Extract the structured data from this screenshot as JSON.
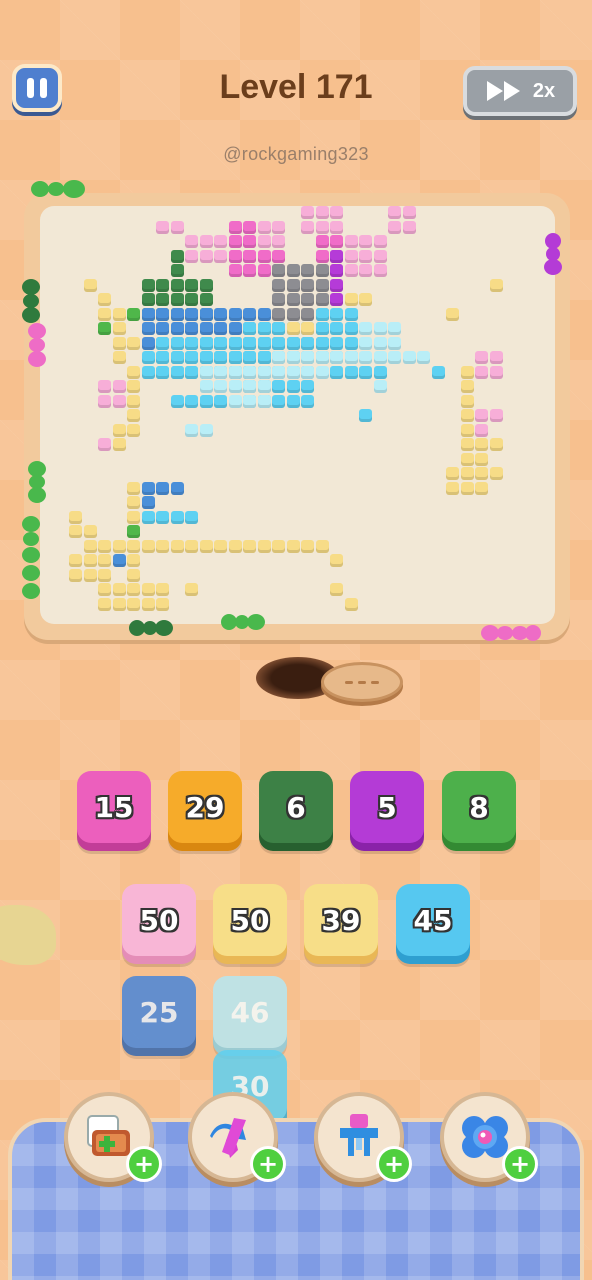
{
  "header": {
    "level_label": "Level 171",
    "watermark": "@rockgaming323",
    "speed_label": "2x"
  },
  "colors": {
    "pink": "#f06cc8",
    "light_pink": "#f7aed8",
    "orange": "#f6ad2a",
    "dark_green": "#3f8a4c",
    "purple": "#b53bd8",
    "green": "#4fb74a",
    "cream": "#f7dc87",
    "yellow": "#f5df8e",
    "cyan": "#5ed1f2",
    "light_cyan": "#b9eef7",
    "blue": "#4a8fd9",
    "grey": "#8d8d92"
  },
  "queue_row": [
    {
      "value": "15",
      "color": "#ec5fbd",
      "dark": "#c23d98"
    },
    {
      "value": "29",
      "color": "#f6ab2a",
      "dark": "#d98710"
    },
    {
      "value": "6",
      "color": "#3d8146",
      "dark": "#27602f"
    },
    {
      "value": "5",
      "color": "#b43bd6",
      "dark": "#8a22a9"
    },
    {
      "value": "8",
      "color": "#4db04b",
      "dark": "#338a33"
    }
  ],
  "stock": [
    {
      "value": "50",
      "color": "#f8b6d6",
      "dark": "#e48db7",
      "faded": false
    },
    {
      "value": "50",
      "color": "#f7de88",
      "dark": "#e9b755",
      "faded": false
    },
    {
      "value": "39",
      "color": "#f7de88",
      "dark": "#e9b755",
      "faded": false
    },
    {
      "value": "45",
      "color": "#56c8f0",
      "dark": "#2f9fd0",
      "faded": false
    },
    {
      "value": "25",
      "color": "#4a86d8",
      "dark": "#3466ad",
      "faded": true
    },
    {
      "value": "46",
      "color": "#b6e7f2",
      "dark": "#8ccddd",
      "faded": true
    },
    {
      "value": "30",
      "color": "#5fd0f0",
      "dark": "#3aabd0",
      "faded": true
    }
  ],
  "boosters": [
    {
      "name": "add-tray-booster",
      "icon": "tray-plus-icon"
    },
    {
      "name": "swap-booster",
      "icon": "swap-arrows-icon"
    },
    {
      "name": "magnet-booster",
      "icon": "magnet-icon"
    },
    {
      "name": "shield-booster",
      "icon": "shield-gem-icon"
    }
  ],
  "booster_badge": "+"
}
